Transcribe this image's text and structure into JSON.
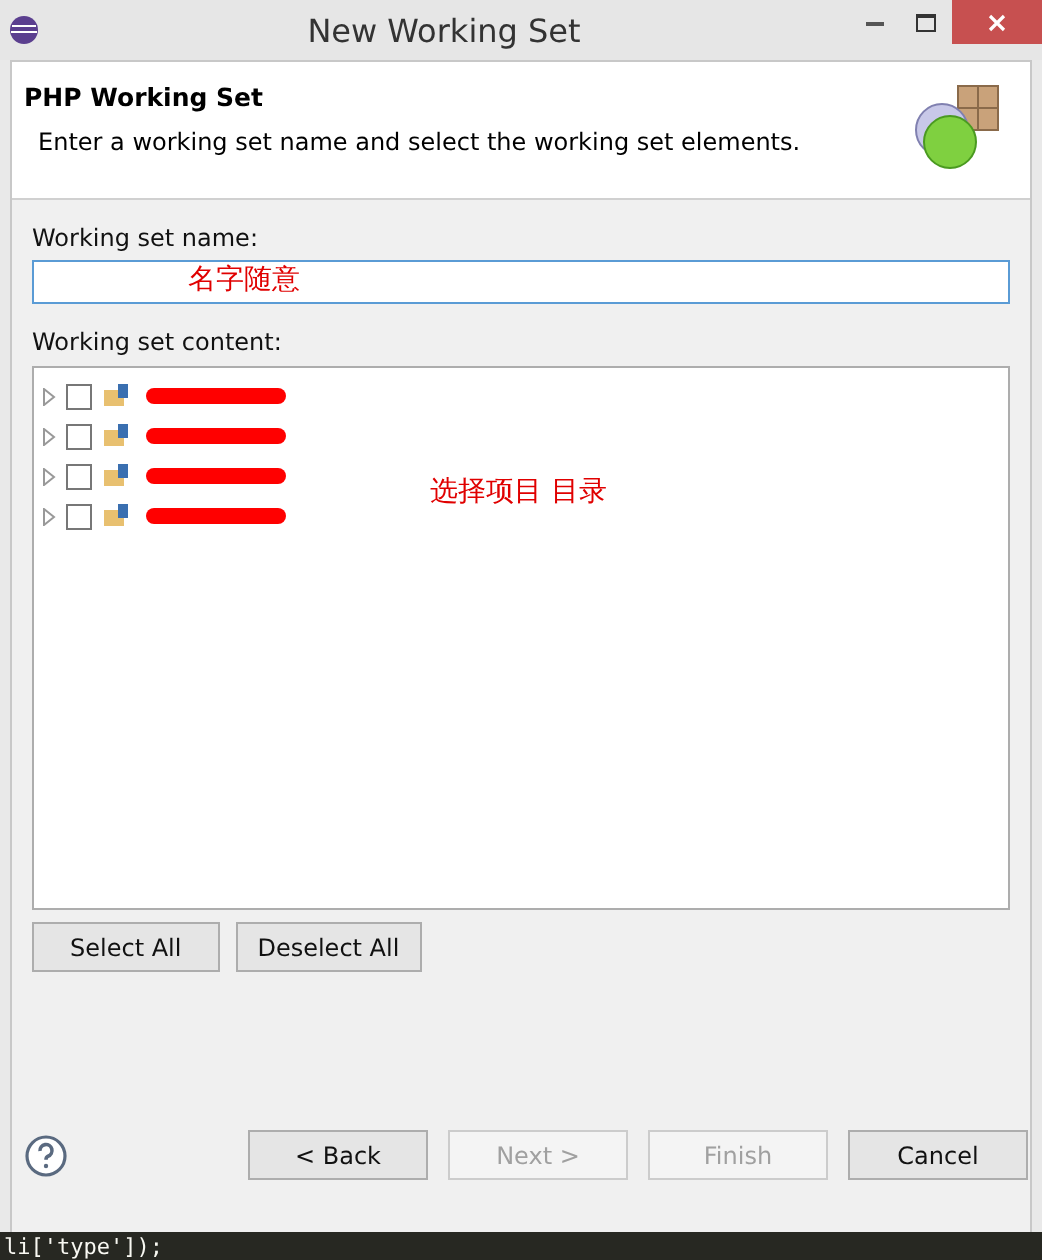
{
  "window": {
    "title": "New Working Set"
  },
  "header": {
    "title": "PHP Working Set",
    "description": "Enter a working set name and select the working set elements."
  },
  "name_field": {
    "label": "Working set name:",
    "annotation": "名字随意"
  },
  "content": {
    "label": "Working set content:",
    "annotation": "选择项目 目录",
    "items": [
      {
        "checked": false,
        "expanded": false
      },
      {
        "checked": false,
        "expanded": false
      },
      {
        "checked": false,
        "expanded": false
      },
      {
        "checked": false,
        "expanded": false
      }
    ]
  },
  "selection_buttons": [
    "Select All",
    "Deselect All"
  ],
  "buttons": [
    {
      "label": "< Back",
      "disabled": false
    },
    {
      "label": "Next >",
      "disabled": true
    },
    {
      "label": "Finish",
      "disabled": true
    },
    {
      "label": "Cancel",
      "disabled": false
    }
  ],
  "background_code": "li['type']);"
}
